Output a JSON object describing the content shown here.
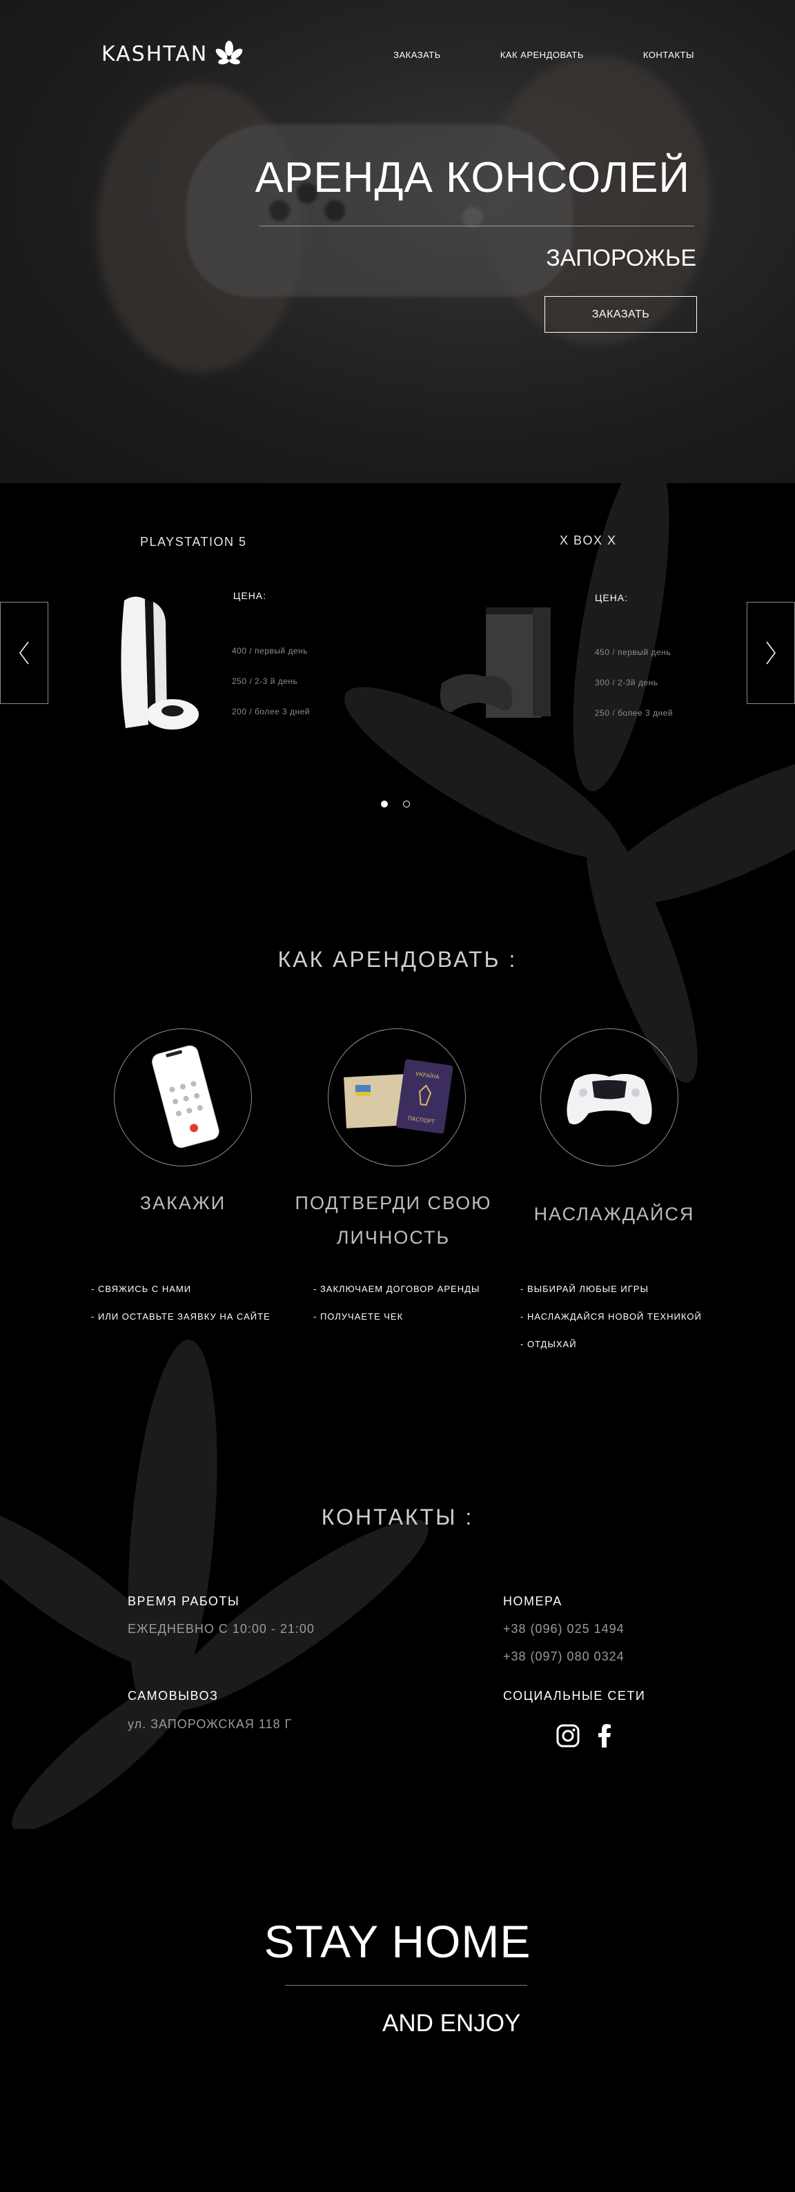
{
  "brand": {
    "logo_text": "KASHTAN"
  },
  "nav": {
    "items": [
      "ЗАКАЗАТЬ",
      "КАК АРЕНДОВАТЬ",
      "КОНТАКТЫ"
    ]
  },
  "hero": {
    "title": "АРЕНДА КОНСОЛЕЙ",
    "city": "ЗАПОРОЖЬЕ",
    "order_button": "ЗАКАЗАТЬ"
  },
  "products": [
    {
      "name": "PLAYSTATION 5",
      "price_label": "ЦЕНА:",
      "prices": [
        "400  / первый день",
        "250  / 2-3 й день",
        "200  / более 3 дней"
      ]
    },
    {
      "name": "X BOX X",
      "price_label": "ЦЕНА:",
      "prices": [
        "450 / первый день",
        "300 / 2-3й день",
        "250 / более 3 дней"
      ]
    }
  ],
  "how_to": {
    "title": "КАК АРЕНДОВАТЬ :",
    "steps": [
      {
        "title": "ЗАКАЖИ",
        "items": [
          "- СВЯЖИСЬ С НАМИ",
          "- ИЛИ ОСТАВЬТЕ ЗАЯВКУ НА САЙТЕ"
        ]
      },
      {
        "title_line1": "ПОДТВЕРДИ СВОЮ",
        "title_line2": "ЛИЧНОСТЬ",
        "items": [
          "- ЗАКЛЮЧАЕМ ДОГОВОР АРЕНДЫ",
          "- ПОЛУЧАЕТЕ ЧЕК"
        ]
      },
      {
        "title": "НАСЛАЖДАЙСЯ",
        "items": [
          "- ВЫБИРАЙ ЛЮБЫЕ ИГРЫ",
          "- НАСЛАЖДАЙСЯ НОВОЙ ТЕХНИКОЙ",
          "- ОТДЫХАЙ"
        ]
      }
    ],
    "passport_text": {
      "country": "УКРАЇНА",
      "doc": "ПАСПОРТ"
    }
  },
  "contacts": {
    "title": "КОНТАКТЫ :",
    "hours_label": "ВРЕМЯ РАБОТЫ",
    "hours_value": "ЕЖЕДНЕВНО С 10:00 - 21:00",
    "pickup_label": "САМОВЫВОЗ",
    "pickup_value": "ул. ЗАПОРОЖСКАЯ 118 Г",
    "phones_label": "НОМЕРА",
    "phones": [
      "+38 (096) 025 1494",
      "+38 (097) 080 0324"
    ],
    "social_label": "СОЦИАЛЬНЫЕ СЕТИ",
    "social_icons": [
      "instagram-icon",
      "facebook-icon"
    ]
  },
  "footer": {
    "headline": "STAY HOME",
    "subline": "AND ENJOY"
  },
  "colors": {
    "background": "#000000",
    "muted_text": "#9b9b9b",
    "border": "#8f8f8f"
  }
}
